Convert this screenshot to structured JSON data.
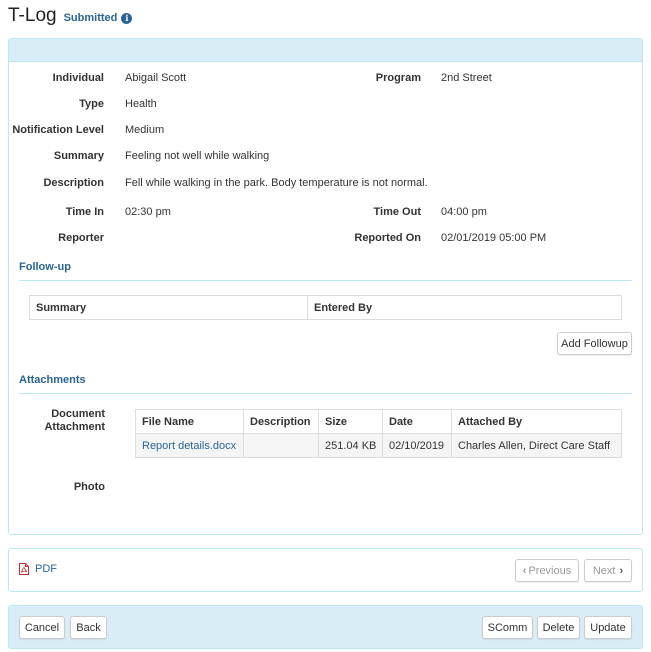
{
  "header": {
    "title": "T-Log",
    "status": "Submitted",
    "status_icon": "info-icon"
  },
  "details": {
    "individual_label": "Individual",
    "individual_value": "Abigail Scott",
    "program_label": "Program",
    "program_value": "2nd Street",
    "type_label": "Type",
    "type_value": "Health",
    "notification_label": "Notification Level",
    "notification_value": "Medium",
    "summary_label": "Summary",
    "summary_value": "Feeling not well while walking",
    "description_label": "Description",
    "description_value": "Fell while walking in the park. Body temperature is not normal.",
    "time_in_label": "Time In",
    "time_in_value": "02:30 pm",
    "time_out_label": "Time Out",
    "time_out_value": "04:00 pm",
    "reporter_label": "Reporter",
    "reporter_value": "",
    "reported_on_label": "Reported On",
    "reported_on_value": "02/01/2019 05:00 PM"
  },
  "followup": {
    "title": "Follow-up",
    "columns": [
      "Summary",
      "Entered By"
    ],
    "add_button": "Add Followup"
  },
  "attachments": {
    "title": "Attachments",
    "document_label": "Document Attachment",
    "columns": [
      "File Name",
      "Description",
      "Size",
      "Date",
      "Attached By"
    ],
    "rows": [
      {
        "file_name": "Report details.docx",
        "description": "",
        "size": "251.04 KB",
        "date": "02/10/2019",
        "attached_by": "Charles Allen, Direct Care Staff"
      }
    ],
    "photo_label": "Photo"
  },
  "pdf_panel": {
    "pdf_label": "PDF",
    "pdf_icon": "pdf-icon",
    "previous_label": "Previous",
    "next_label": "Next"
  },
  "footer": {
    "cancel_label": "Cancel",
    "back_label": "Back",
    "scomm_label": "SComm",
    "delete_label": "Delete",
    "update_label": "Update"
  },
  "colors": {
    "accent": "#2a6496",
    "panel_heading": "#d9edf7",
    "panel_border": "#bce8f1",
    "pdf_red": "#c9302c"
  }
}
